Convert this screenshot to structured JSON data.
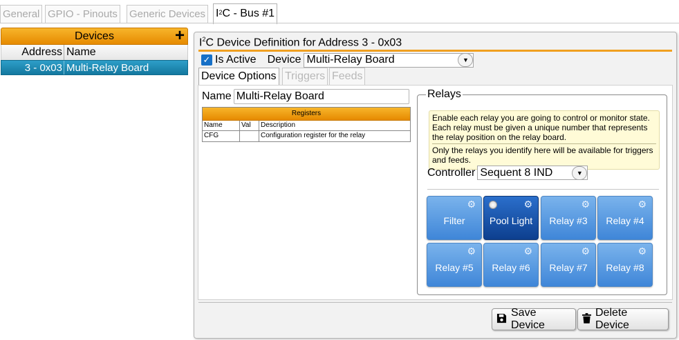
{
  "top_tabs": {
    "general": "General",
    "gpio": "GPIO - Pinouts",
    "generic": "Generic Devices",
    "i2c_prefix": "I",
    "i2c_sup": "2",
    "i2c_suffix": "C - Bus #1"
  },
  "devices": {
    "title": "Devices",
    "add_icon": "+",
    "col_address": "Address",
    "col_name": "Name",
    "rows": [
      {
        "address": "3 - 0x03",
        "name": "Multi-Relay Board"
      }
    ]
  },
  "definition": {
    "title_prefix": "I",
    "title_sup": "2",
    "title_suffix": "C Device Definition for Address 3 - 0x03",
    "is_active_label": "Is Active",
    "is_active": true,
    "check_icon": "✓",
    "device_label": "Device",
    "device_value": "Multi-Relay Board",
    "dropdown_icon": "▼"
  },
  "sub_tabs": {
    "options": "Device Options",
    "triggers": "Triggers",
    "feeds": "Feeds"
  },
  "options": {
    "name_label": "Name",
    "name_value": "Multi-Relay Board",
    "registers": {
      "title": "Registers",
      "columns": [
        "Name",
        "Val",
        "Description"
      ],
      "rows": [
        {
          "name": "CFG",
          "val": "",
          "description": "Configuration register for the relay"
        }
      ]
    }
  },
  "relays": {
    "legend": "Relays",
    "note_1": "Enable each relay you are going to control or monitor state. Each relay must be given a unique number that represents the relay position on the relay board.",
    "note_2": "Only the relays you identify here will be available for triggers and feeds.",
    "controller_label": "Controller",
    "controller_value": "Sequent 8 IND",
    "gear_icon": "⚙",
    "buttons": [
      {
        "label": "Filter",
        "active": false
      },
      {
        "label": "Pool Light",
        "active": true
      },
      {
        "label": "Relay #3",
        "active": false
      },
      {
        "label": "Relay #4",
        "active": false
      },
      {
        "label": "Relay #5",
        "active": false
      },
      {
        "label": "Relay #6",
        "active": false
      },
      {
        "label": "Relay #7",
        "active": false
      },
      {
        "label": "Relay #8",
        "active": false
      }
    ]
  },
  "actions": {
    "save_label": "Save Device",
    "save_icon": "floppy-disk-icon",
    "delete_label": "Delete Device",
    "delete_icon": "trash-icon"
  },
  "colors": {
    "accent_orange": "#f0a020",
    "selected_row": "#1a88b3",
    "relay_blue": "#5a9ce2",
    "relay_active": "#1a54a8"
  }
}
